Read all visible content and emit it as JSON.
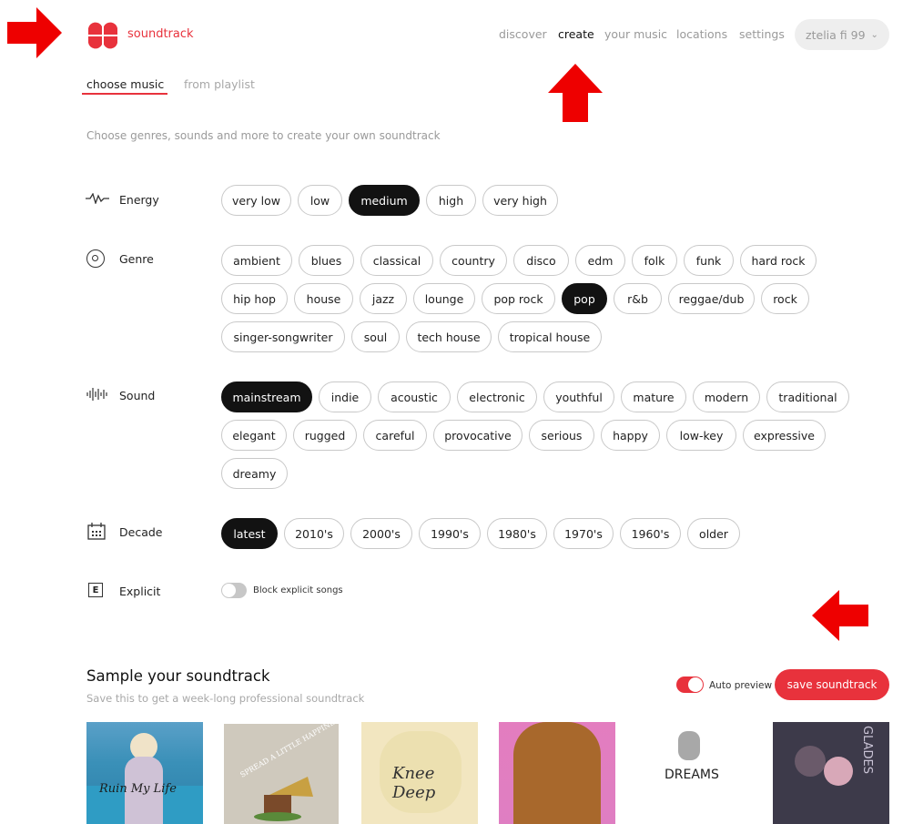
{
  "header": {
    "brand": "soundtrack",
    "nav": [
      {
        "label": "discover",
        "active": false
      },
      {
        "label": "create",
        "active": true
      },
      {
        "label": "your music",
        "active": false
      },
      {
        "label": "locations",
        "active": false
      },
      {
        "label": "settings",
        "active": false
      }
    ],
    "user": "ztelia fi 99",
    "accent_color": "#e8323c"
  },
  "tabs": [
    {
      "label": "choose music",
      "active": true
    },
    {
      "label": "from playlist",
      "active": false
    }
  ],
  "intro": "Choose genres, sounds and more to create your own soundtrack",
  "filters": {
    "energy": {
      "label": "Energy",
      "icon": "waveform-icon",
      "options": [
        "very low",
        "low",
        "medium",
        "high",
        "very high"
      ],
      "selected": [
        "medium"
      ]
    },
    "genre": {
      "label": "Genre",
      "icon": "vinyl-record-icon",
      "options": [
        "ambient",
        "blues",
        "classical",
        "country",
        "disco",
        "edm",
        "folk",
        "funk",
        "hard rock",
        "hip hop",
        "house",
        "jazz",
        "lounge",
        "pop rock",
        "pop",
        "r&b",
        "reggae/dub",
        "rock",
        "singer-songwriter",
        "soul",
        "tech house",
        "tropical house"
      ],
      "selected": [
        "pop"
      ]
    },
    "sound": {
      "label": "Sound",
      "icon": "sound-bars-icon",
      "options": [
        "mainstream",
        "indie",
        "acoustic",
        "electronic",
        "youthful",
        "mature",
        "modern",
        "traditional",
        "elegant",
        "rugged",
        "careful",
        "provocative",
        "serious",
        "happy",
        "low-key",
        "expressive",
        "dreamy"
      ],
      "selected": [
        "mainstream"
      ]
    },
    "decade": {
      "label": "Decade",
      "icon": "calendar-icon",
      "options": [
        "latest",
        "2010's",
        "2000's",
        "1990's",
        "1980's",
        "1970's",
        "1960's",
        "older"
      ],
      "selected": [
        "latest"
      ]
    },
    "explicit": {
      "label": "Explicit",
      "icon": "explicit-e-icon",
      "toggle_label": "Block explicit songs",
      "enabled": false
    }
  },
  "sample": {
    "title": "Sample your soundtrack",
    "subtitle": "Save this to get a week-long professional soundtrack",
    "auto_preview_label": "Auto preview",
    "auto_preview": true,
    "save_label": "save soundtrack",
    "covers": [
      {
        "text": "Ruin My Life"
      },
      {
        "text": "SPREAD A LITTLE HAPPINESS"
      },
      {
        "text": "Knee Deep"
      },
      {
        "text": ""
      },
      {
        "text": "DREAMS"
      },
      {
        "text": "GLADES"
      }
    ]
  }
}
